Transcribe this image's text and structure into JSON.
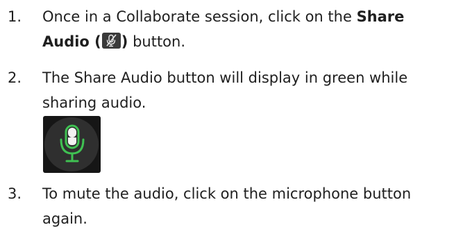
{
  "steps": [
    {
      "number": "1.",
      "line1_before": "Once in a Collaborate session, click on the ",
      "line1_bold": "Share",
      "line2_bold_before": "Audio (",
      "line2_bold_after": ")",
      "line2_after": " button.",
      "icon": "microphone-muted-icon"
    },
    {
      "number": "2.",
      "line1": "The Share Audio button will display in green while",
      "line2": "sharing audio.",
      "icon": "microphone-active-icon"
    },
    {
      "number": "3.",
      "line1": "To mute the audio, click on the microphone button",
      "line2": "again."
    }
  ],
  "colors": {
    "text": "#1f1f1f",
    "mic_active": "#3fc152",
    "mic_badge_bg": "#2f2f2f"
  }
}
